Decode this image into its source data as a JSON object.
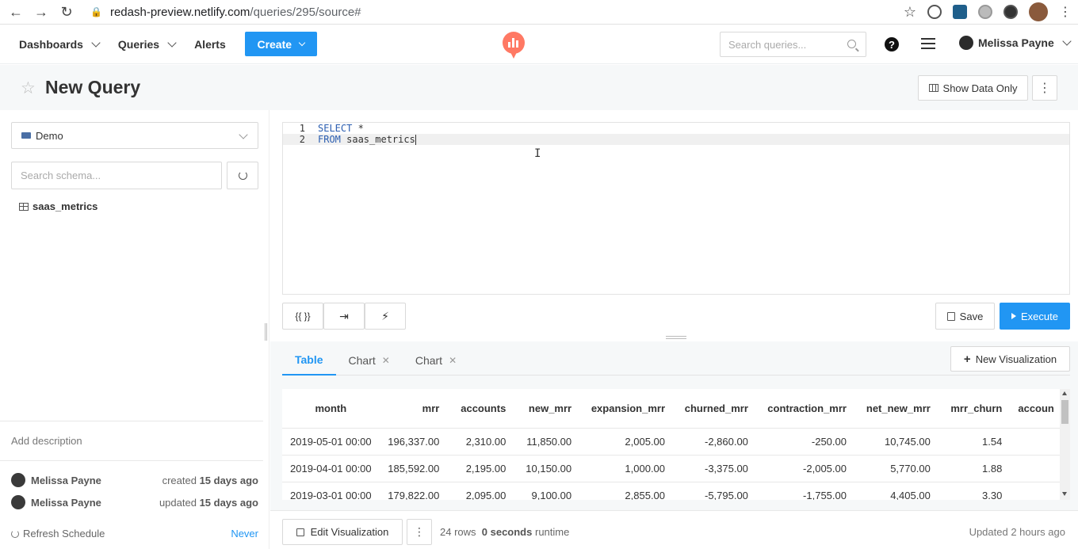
{
  "browser": {
    "url_host": "redash-preview.netlify.com",
    "url_path": "/queries/295/source#"
  },
  "header": {
    "menu": [
      {
        "label": "Dashboards"
      },
      {
        "label": "Queries"
      },
      {
        "label": "Alerts"
      }
    ],
    "create_label": "Create",
    "search_placeholder": "Search queries...",
    "user_name": "Melissa Payne"
  },
  "titlebar": {
    "title": "New Query",
    "show_data_label": "Show Data Only"
  },
  "sidebar": {
    "datasource": "Demo",
    "schema_placeholder": "Search schema...",
    "schema_items": [
      "saas_metrics"
    ],
    "add_description": "Add description",
    "meta": [
      {
        "user": "Melissa Payne",
        "action": "created",
        "when": "15 days ago"
      },
      {
        "user": "Melissa Payne",
        "action": "updated",
        "when": "15 days ago"
      }
    ],
    "refresh_label": "Refresh Schedule",
    "refresh_value": "Never"
  },
  "editor": {
    "lines": [
      {
        "num": "1",
        "kw": "SELECT",
        "rest": " *"
      },
      {
        "num": "2",
        "kw": "FROM",
        "rest": " saas_metrics"
      }
    ]
  },
  "toolbar": {
    "params_label": "{{ }}",
    "save_label": "Save",
    "execute_label": "Execute"
  },
  "results": {
    "tabs": [
      {
        "label": "Table",
        "active": true
      },
      {
        "label": "Chart",
        "closable": true
      },
      {
        "label": "Chart",
        "closable": true
      }
    ],
    "new_vis_label": "New Visualization",
    "columns": [
      "month",
      "mrr",
      "accounts",
      "new_mrr",
      "expansion_mrr",
      "churned_mrr",
      "contraction_mrr",
      "net_new_mrr",
      "mrr_churn",
      "accoun"
    ],
    "rows": [
      [
        "2019-05-01 00:00",
        "196,337.00",
        "2,310.00",
        "11,850.00",
        "2,005.00",
        "-2,860.00",
        "-250.00",
        "10,745.00",
        "1.54",
        ""
      ],
      [
        "2019-04-01 00:00",
        "185,592.00",
        "2,195.00",
        "10,150.00",
        "1,000.00",
        "-3,375.00",
        "-2,005.00",
        "5,770.00",
        "1.88",
        ""
      ],
      [
        "2019-03-01 00:00",
        "179,822.00",
        "2,095.00",
        "9,100.00",
        "2,855.00",
        "-5,795.00",
        "-1,755.00",
        "4,405.00",
        "3.30",
        ""
      ]
    ],
    "edit_vis_label": "Edit Visualization",
    "rows_count": "24 rows",
    "runtime": "0 seconds",
    "runtime_suffix": "runtime",
    "updated": "Updated 2 hours ago"
  },
  "colors": {
    "accent": "#2196f3",
    "logo": "#ff7964"
  }
}
